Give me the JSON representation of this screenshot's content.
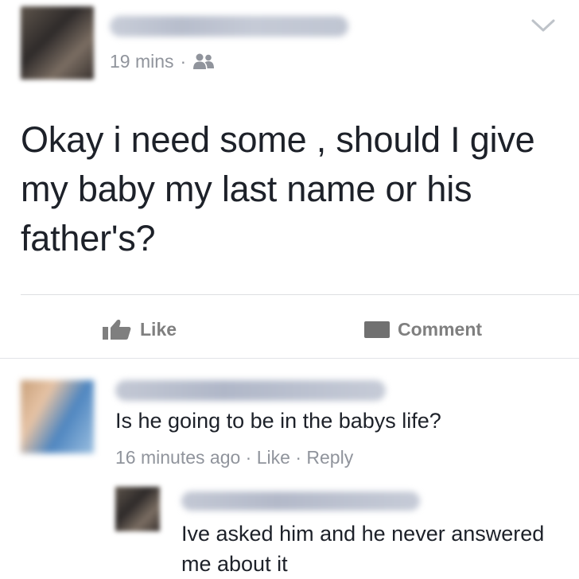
{
  "post": {
    "author_name": "",
    "timestamp": "19 mins",
    "separator": "·",
    "audience_icon": "friends-icon",
    "menu_icon": "chevron-down-icon",
    "text": "Okay i need some , should I give my baby my last name or his father's?"
  },
  "actions": {
    "like_label": "Like",
    "comment_label": "Comment"
  },
  "comments": [
    {
      "author_name": "",
      "text": "Is he going to be in the babys life?",
      "time": "16 minutes ago",
      "sep": " · ",
      "like_label": "Like",
      "reply_label": "Reply",
      "replies": [
        {
          "author_name": "",
          "text": "Ive asked him and he never answered me about it"
        }
      ]
    }
  ],
  "colors": {
    "text": "#1d2129",
    "meta": "#90949c",
    "action": "#7f7f7f",
    "divider": "#dddfe2"
  }
}
